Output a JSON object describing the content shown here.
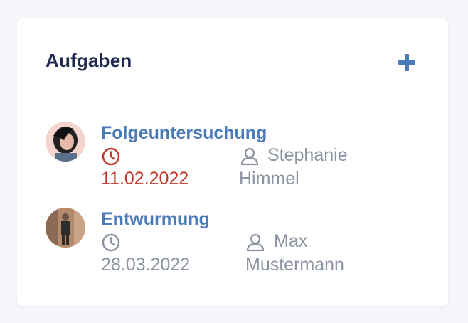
{
  "panel": {
    "title": "Aufgaben",
    "add_icon": "plus-icon"
  },
  "tasks": [
    {
      "title": "Folgeuntersuchung",
      "due_date": "11.02.2022",
      "overdue": true,
      "assignee": "Stephanie Himmel",
      "avatar": "user-avatar"
    },
    {
      "title": "Entwurmung",
      "due_date": "28.03.2022",
      "overdue": false,
      "assignee": "Max Mustermann",
      "avatar": "user-avatar"
    }
  ],
  "colors": {
    "title": "#1f2a4d",
    "accent": "#4a7ab8",
    "overdue": "#c0392b",
    "muted": "#8c93a3"
  }
}
